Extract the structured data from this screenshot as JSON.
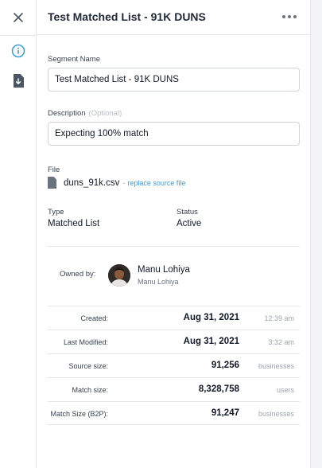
{
  "header": {
    "title": "Test Matched List - 91K DUNS"
  },
  "rail": {
    "icons": [
      "close-icon",
      "info-icon",
      "download-file-icon"
    ],
    "active_color": "#3b9dd8"
  },
  "form": {
    "segment_name": {
      "label": "Segment Name",
      "value": "Test Matched List - 91K DUNS"
    },
    "description": {
      "label": "Description",
      "optional": "(Optional)",
      "value": "Expecting 100% match"
    }
  },
  "file": {
    "label": "File",
    "name": "duns_91k.csv",
    "separator": "-",
    "replace_link": "replace source file"
  },
  "details": {
    "type_label": "Type",
    "type_value": "Matched List",
    "status_label": "Status",
    "status_value": "Active"
  },
  "owner": {
    "label": "Owned by:",
    "name": "Manu Lohiya",
    "sub": "Manu Lohiya"
  },
  "stats": [
    {
      "label": "Created:",
      "value": "Aug 31, 2021",
      "unit": "12:39 am"
    },
    {
      "label": "Last Modified:",
      "value": "Aug 31, 2021",
      "unit": "3:32 am"
    },
    {
      "label": "Source size:",
      "value": "91,256",
      "unit": "businesses"
    },
    {
      "label": "Match size:",
      "value": "8,328,758",
      "unit": "users"
    },
    {
      "label": "Match Size (B2P):",
      "value": "91,247",
      "unit": "businesses"
    }
  ]
}
